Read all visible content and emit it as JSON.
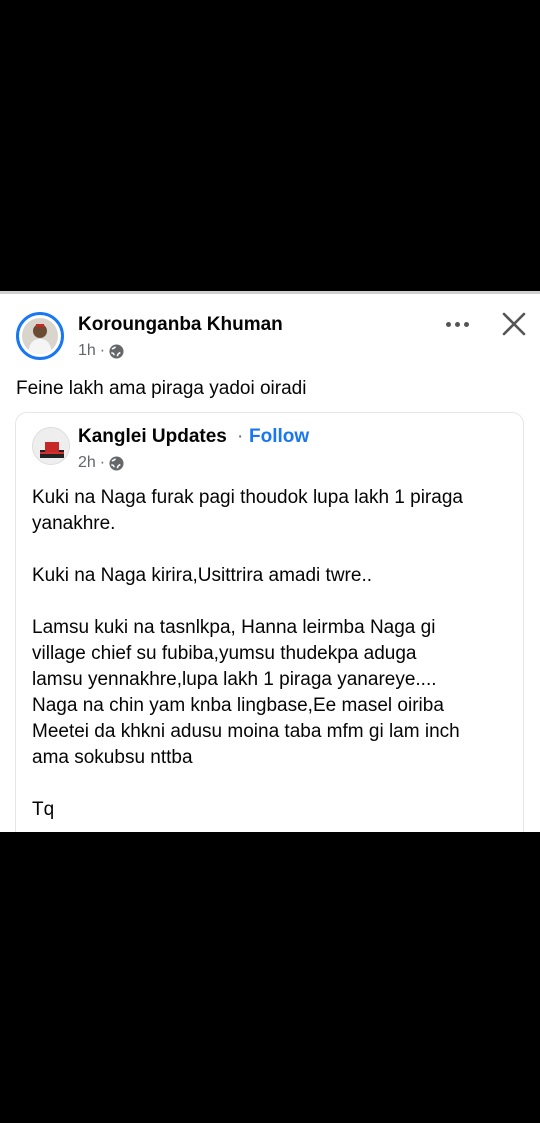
{
  "post": {
    "author": "Korounganba Khuman",
    "time": "1h",
    "separator": "·",
    "text": "Feine lakh ama piraga yadoi oiradi"
  },
  "shared_post": {
    "page_name": "Kanglei Updates",
    "separator": "·",
    "follow_label": "Follow",
    "time": "2h",
    "paragraphs": [
      [
        "Kuki na Naga furak pagi thoudok lupa lakh 1 piraga",
        "yanakhre."
      ],
      [
        "Kuki na Naga kirira,Usittrira amadi twre.."
      ],
      [
        "Lamsu kuki na tasnlkpa, Hanna leirmba Naga gi",
        "village chief su fubiba,yumsu thudekpa aduga",
        "lamsu yennakhre,lupa lakh 1 piraga yanareye....",
        "Naga na chin yam knba lingbase,Ee masel oiriba",
        "Meetei da khkni adusu moina taba mfm gi lam inch",
        "ama sokubsu nttba"
      ],
      [
        "Tq"
      ]
    ]
  },
  "icons": {
    "more": "more-icon",
    "close": "close-icon",
    "audience": "globe-icon"
  },
  "colors": {
    "accent": "#1877f2",
    "secondary_text": "#65676b",
    "background": "#000000"
  }
}
